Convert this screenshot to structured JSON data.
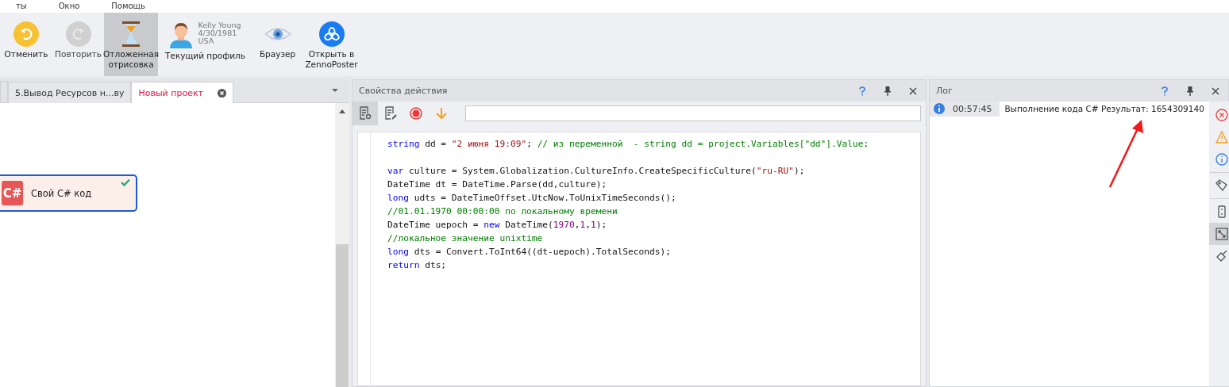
{
  "menu": [
    "ты",
    "Окно",
    "Помощь"
  ],
  "toolbar": [
    {
      "kind": "undo",
      "label": "Отменить",
      "disabled": false,
      "selected": false
    },
    {
      "kind": "redo",
      "label": "Повторить",
      "disabled": true,
      "selected": false
    },
    {
      "kind": "hourglass",
      "label": "Отложенная отрисовка",
      "selected": true
    },
    {
      "kind": "profile",
      "label": "Текущий профиль",
      "selected": false,
      "profile_lines": [
        "Kelly Young",
        "4/30/1981",
        "USA"
      ]
    },
    {
      "kind": "eye",
      "label": "Браузер",
      "selected": false
    },
    {
      "kind": "zenno",
      "label": "Открыть в ZennoPoster",
      "selected": false
    }
  ],
  "project_tabs": [
    {
      "label": "5.Вывод Ресурсов н...ву",
      "selected": false
    },
    {
      "label": "Новый проект",
      "selected": true
    }
  ],
  "node": {
    "badge": "C#",
    "label": "Свой C# код",
    "done": true,
    "selected": true
  },
  "properties": {
    "title": "Свойства действия",
    "tools": [
      {
        "kind": "settings",
        "selected": true
      },
      {
        "kind": "edit",
        "selected": false
      },
      {
        "kind": "record",
        "selected": false
      },
      {
        "kind": "down",
        "selected": false
      }
    ],
    "code": [
      {
        "kind": "code",
        "tokens": [
          {
            "kind": "kw",
            "s": "string"
          },
          {
            "kind": "plain",
            "s": " dd = "
          },
          {
            "kind": "str",
            "s": "\"2 июня 19:09\""
          },
          {
            "kind": "plain",
            "s": "; "
          },
          {
            "kind": "cm",
            "s": "// из переменной  - string dd = project.Variables[\"dd\"].Value;"
          }
        ]
      },
      {
        "kind": "blank"
      },
      {
        "kind": "code",
        "tokens": [
          {
            "kind": "kw",
            "s": "var"
          },
          {
            "kind": "plain",
            "s": " culture = System.Globalization.CultureInfo.CreateSpecificCulture("
          },
          {
            "kind": "str",
            "s": "\"ru-RU\""
          },
          {
            "kind": "plain",
            "s": ");"
          }
        ]
      },
      {
        "kind": "code",
        "tokens": [
          {
            "kind": "plain",
            "s": "DateTime dt = DateTime.Parse(dd,culture);"
          }
        ]
      },
      {
        "kind": "code",
        "tokens": [
          {
            "kind": "kw",
            "s": "long"
          },
          {
            "kind": "plain",
            "s": " udts = DateTimeOffset.UtcNow.ToUnixTimeSeconds();"
          }
        ]
      },
      {
        "kind": "code",
        "tokens": [
          {
            "kind": "cm",
            "s": "//01.01.1970 00:00:00 по локальному времени"
          }
        ]
      },
      {
        "kind": "code",
        "tokens": [
          {
            "kind": "plain",
            "s": "DateTime uepoch = "
          },
          {
            "kind": "kw",
            "s": "new"
          },
          {
            "kind": "plain",
            "s": " DateTime("
          },
          {
            "kind": "num",
            "s": "1970"
          },
          {
            "kind": "plain",
            "s": ","
          },
          {
            "kind": "num",
            "s": "1"
          },
          {
            "kind": "plain",
            "s": ","
          },
          {
            "kind": "num",
            "s": "1"
          },
          {
            "kind": "plain",
            "s": ");"
          }
        ]
      },
      {
        "kind": "code",
        "tokens": [
          {
            "kind": "cm",
            "s": "//локальное значение unixtime"
          }
        ]
      },
      {
        "kind": "code",
        "tokens": [
          {
            "kind": "kw",
            "s": "long"
          },
          {
            "kind": "plain",
            "s": " dts = Convert.ToInt64((dt-uepoch).TotalSeconds);"
          }
        ]
      },
      {
        "kind": "code",
        "tokens": [
          {
            "kind": "kw",
            "s": "return"
          },
          {
            "kind": "plain",
            "s": " dts;"
          }
        ]
      }
    ]
  },
  "log": {
    "title": "Лог",
    "entries": [
      {
        "kind": "info",
        "time": "00:57:45",
        "message": "Выполнение кода C#  Результат: 1654309140"
      }
    ],
    "filters": [
      {
        "kind": "error",
        "selected": false
      },
      {
        "kind": "warning",
        "selected": false
      },
      {
        "kind": "info",
        "selected": false
      },
      {
        "kind": "sep"
      },
      {
        "kind": "tag",
        "selected": false
      },
      {
        "kind": "sep"
      },
      {
        "kind": "scroll",
        "selected": false
      },
      {
        "kind": "expand",
        "selected": true
      },
      {
        "kind": "brush",
        "selected": false
      }
    ]
  }
}
